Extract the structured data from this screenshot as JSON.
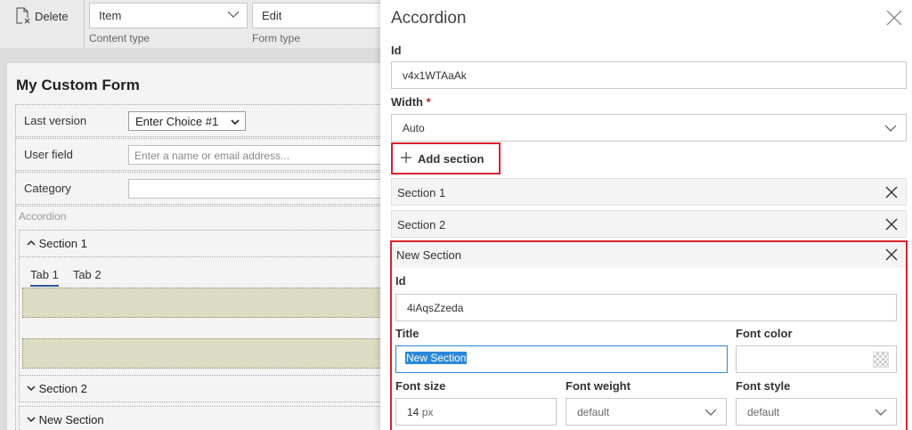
{
  "toolbar": {
    "delete_label": "Delete",
    "content_type_value": "Item",
    "content_type_caption": "Content type",
    "form_type_value": "Edit",
    "form_type_caption": "Form type"
  },
  "form": {
    "title": "My Custom Form",
    "fields": [
      {
        "label": "Last version",
        "value": "Enter Choice #1"
      },
      {
        "label": "User field",
        "placeholder": "Enter a name or email address..."
      },
      {
        "label": "Category"
      }
    ],
    "accordion_label": "Accordion",
    "sections": [
      {
        "title": "Section 1",
        "expanded": true
      },
      {
        "title": "Section 2",
        "expanded": false
      },
      {
        "title": "New Section",
        "expanded": false
      }
    ],
    "tabs": [
      "Tab 1",
      "Tab 2"
    ]
  },
  "panel": {
    "title": "Accordion",
    "id_label": "Id",
    "id_value": "v4x1WTAaAk",
    "width_label": "Width",
    "width_required": "*",
    "width_value": "Auto",
    "add_section_label": "Add section",
    "sections": [
      "Section 1",
      "Section 2"
    ],
    "new_section": {
      "header": "New Section",
      "id_label": "Id",
      "id_value": "4iAqsZzeda",
      "title_label": "Title",
      "title_value": "New Section",
      "font_color_label": "Font color",
      "font_size_label": "Font size",
      "font_size_value": "14",
      "font_size_unit": "px",
      "font_weight_label": "Font weight",
      "font_weight_value": "default",
      "font_style_label": "Font style",
      "font_style_value": "default"
    }
  },
  "colors": {
    "highlight_border": "#d9232e",
    "focus_blue": "#2b88d8",
    "tab_panel": "#dcdcc4"
  }
}
